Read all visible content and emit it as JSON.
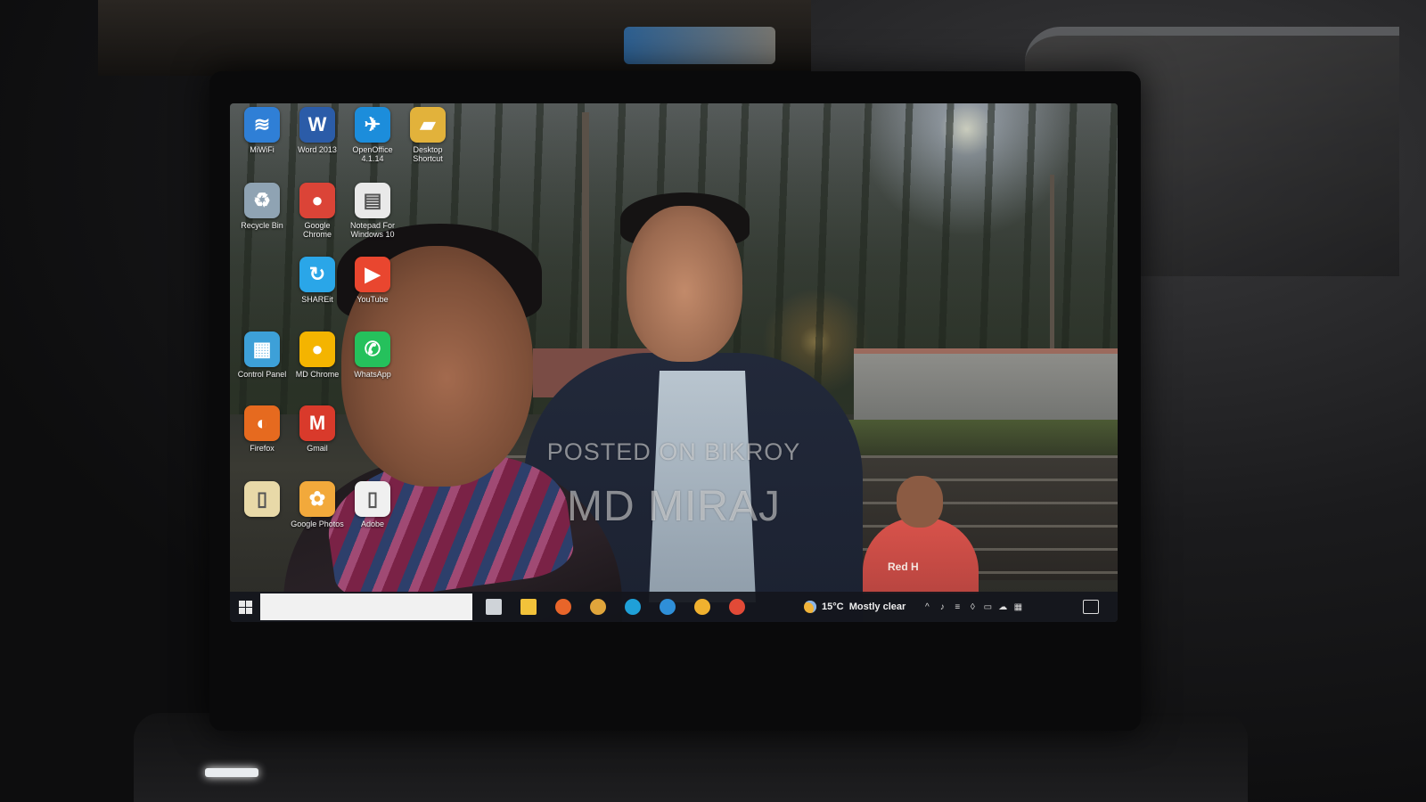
{
  "desktop": {
    "icons": [
      {
        "label": "MiWiFi",
        "name": "miwifi-shortcut",
        "icon": "network-icon",
        "glyph": "≋",
        "color": "#2f7fd6"
      },
      {
        "label": "Word 2013",
        "name": "word-2013-shortcut",
        "icon": "word-icon",
        "glyph": "W",
        "color": "#2b5ca8"
      },
      {
        "label": "OpenOffice 4.1.14",
        "name": "openoffice-shortcut",
        "icon": "openoffice-icon",
        "glyph": "✈",
        "color": "#1c8ddb"
      },
      {
        "label": "Desktop Shortcut",
        "name": "desktop-shortcut",
        "icon": "folder-icon",
        "glyph": "▰",
        "color": "#e2b23b"
      },
      {
        "label": "Recycle Bin",
        "name": "recycle-bin",
        "icon": "recycle-bin-icon",
        "glyph": "♻",
        "color": "#8fa3b3"
      },
      {
        "label": "Google Chrome",
        "name": "google-chrome-shortcut",
        "icon": "chrome-icon",
        "glyph": "●",
        "color": "#db4437"
      },
      {
        "label": "Notepad For Windows 10",
        "name": "notepad-shortcut",
        "icon": "notepad-icon",
        "glyph": "▤",
        "color": "#e9e9e9"
      },
      {
        "label": "SHAREit",
        "name": "shareit-shortcut",
        "icon": "shareit-icon",
        "glyph": "↻",
        "color": "#2aa6e8"
      },
      {
        "label": "YouTube",
        "name": "youtube-shortcut",
        "icon": "youtube-icon",
        "glyph": "▶",
        "color": "#e9462f"
      },
      {
        "label": "Control Panel",
        "name": "control-panel-shortcut",
        "icon": "control-panel-icon",
        "glyph": "▦",
        "color": "#3da0d8"
      },
      {
        "label": "MD Chrome",
        "name": "md-chrome-shortcut",
        "icon": "chrome-icon",
        "glyph": "●",
        "color": "#f4b400"
      },
      {
        "label": "WhatsApp",
        "name": "whatsapp-shortcut",
        "icon": "whatsapp-icon",
        "glyph": "✆",
        "color": "#25c15c"
      },
      {
        "label": "Firefox",
        "name": "firefox-shortcut",
        "icon": "firefox-icon",
        "glyph": "◐",
        "color": "#e66a1f"
      },
      {
        "label": "Gmail",
        "name": "gmail-shortcut",
        "icon": "gmail-icon",
        "glyph": "M",
        "color": "#d93a2b"
      },
      {
        "label": "",
        "name": "file-shortcut",
        "icon": "file-icon",
        "glyph": "▯",
        "color": "#e8d9a8"
      },
      {
        "label": "Google Photos",
        "name": "google-photos-shortcut",
        "icon": "google-photos-icon",
        "glyph": "✿",
        "color": "#f2a93b"
      },
      {
        "label": "Adobe",
        "name": "adobe-shortcut",
        "icon": "document-icon",
        "glyph": "▯",
        "color": "#f0f0f0"
      }
    ]
  },
  "watermark": {
    "line1": "POSTED ON BIKROY",
    "line2": "MD MIRAJ"
  },
  "wallpaper": {
    "shirt_text": "Red H"
  },
  "taskbar": {
    "search_placeholder": "",
    "pinned": [
      {
        "name": "task-view-button",
        "icon": "task-view-icon",
        "color": "#cfd3d8"
      },
      {
        "name": "file-explorer-button",
        "icon": "file-explorer-icon",
        "color": "#f2c23a"
      },
      {
        "name": "firefox-taskbar-button",
        "icon": "firefox-icon",
        "color": "#e8652a"
      },
      {
        "name": "photos-taskbar-button",
        "icon": "colorful-app-icon",
        "color": "#e0a53b"
      },
      {
        "name": "edge-taskbar-button",
        "icon": "edge-icon",
        "color": "#1fa0d8"
      },
      {
        "name": "store-taskbar-button",
        "icon": "store-icon",
        "color": "#2f8fd8"
      },
      {
        "name": "google-photos-taskbar-button",
        "icon": "google-photos-icon",
        "color": "#f0b12f"
      },
      {
        "name": "chrome-taskbar-button",
        "icon": "chrome-icon",
        "color": "#e24a37"
      }
    ],
    "weather": {
      "temperature": "15°C",
      "condition": "Mostly clear"
    },
    "tray_icons": [
      "chevron-up-icon",
      "speaker-icon",
      "network-icon",
      "shield-icon",
      "battery-icon",
      "cloud-icon",
      "keyboard-icon"
    ],
    "clock": {
      "time": "",
      "date": ""
    }
  }
}
